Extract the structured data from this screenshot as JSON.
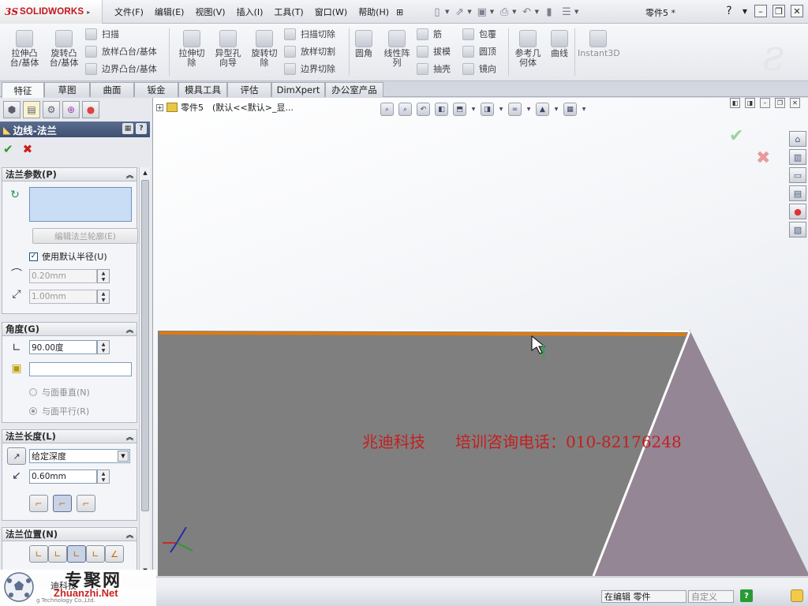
{
  "app": {
    "brand_prefix": "3S",
    "brand_name": "SOLIDWORKS",
    "doc_title": "零件5 *"
  },
  "menu": [
    "文件(F)",
    "编辑(E)",
    "视图(V)",
    "插入(I)",
    "工具(T)",
    "窗口(W)",
    "帮助(H)"
  ],
  "ribbon": {
    "extrude_boss": "拉伸凸\n台/基体",
    "revolve_boss": "旋转凸\n台/基体",
    "sweep": "扫描",
    "loft_boss": "放样凸台/基体",
    "boundary_boss": "边界凸台/基体",
    "extrude_cut": "拉伸切\n除",
    "hole_wizard": "异型孔\n向导",
    "revolve_cut": "旋转切\n除",
    "swept_cut": "扫描切除",
    "lofted_cut": "放样切割",
    "boundary_cut": "边界切除",
    "fillet": "圆角",
    "linear_pattern": "线性阵\n列",
    "rib": "筋",
    "draft": "拔模",
    "shell": "抽壳",
    "wrap": "包覆",
    "dome": "圆顶",
    "mirror": "镜向",
    "ref_geometry": "参考几\n何体",
    "curves": "曲线",
    "instant3d": "Instant3D"
  },
  "tabs": [
    "特征",
    "草图",
    "曲面",
    "钣金",
    "模具工具",
    "评估",
    "DimXpert",
    "办公室产品"
  ],
  "pm": {
    "title": "边线-法兰",
    "help": "?",
    "ok_symbol": "✔",
    "cancel_symbol": "✖",
    "flange_params": {
      "header": "法兰参数(P)",
      "edit_profile_button": "编辑法兰轮廓(E)",
      "use_default_radius_label": "使用默认半径(U)",
      "use_default_radius_checked": true,
      "radius_value": "0.20mm",
      "gap_value": "1.00mm"
    },
    "angle": {
      "header": "角度(G)",
      "angle_value": "90.00度",
      "perpendicular_label": "与面垂直(N)",
      "parallel_label": "与面平行(R)",
      "selected_option": "parallel"
    },
    "length": {
      "header": "法兰长度(L)",
      "end_condition": "给定深度",
      "length_value": "0.60mm"
    },
    "position": {
      "header": "法兰位置(N)"
    }
  },
  "graphics": {
    "tree_label": "零件5　(默认<<默认>_显...",
    "watermark_company": "兆迪科技",
    "watermark_phone": "培训咨询电话：010-82176248",
    "plate_color": "#7f7f7f",
    "flange_color": "#948694",
    "edge_highlight": "#e07a10"
  },
  "status": {
    "editing": "在编辑 零件",
    "custom": "自定义",
    "help": "?"
  },
  "stamp": {
    "cn": "专聚网",
    "url": "Zhuanzhi.Net",
    "small": "迪科技",
    "company": "g Technology Co.,Ltd."
  },
  "colors": {
    "brand_red": "#c3151b",
    "pm_header": "#4a5d80",
    "ok_green": "#2a9a2a",
    "cancel_red": "#cc1a1a"
  }
}
